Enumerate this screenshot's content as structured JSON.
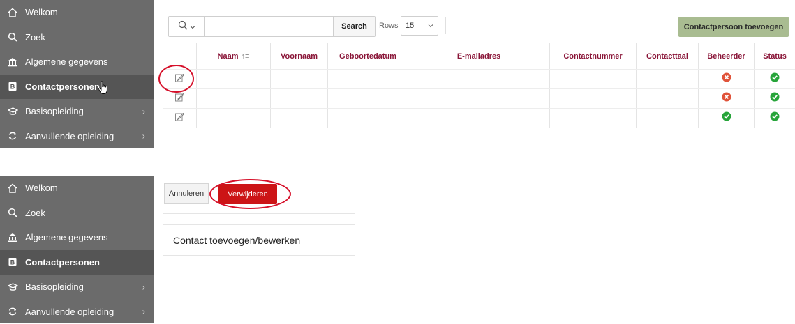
{
  "nav": {
    "items": [
      {
        "label": "Welkom",
        "icon": "home-icon",
        "active": false,
        "chevron": false
      },
      {
        "label": "Zoek",
        "icon": "search-icon",
        "active": false,
        "chevron": false
      },
      {
        "label": "Algemene gegevens",
        "icon": "bank-icon",
        "active": false,
        "chevron": false
      },
      {
        "label": "Contactpersonen",
        "icon": "contact-card-icon",
        "active": true,
        "chevron": false
      },
      {
        "label": "Basisopleiding",
        "icon": "graduation-cap-icon",
        "active": false,
        "chevron": true
      },
      {
        "label": "Aanvullende opleiding",
        "icon": "refresh-icon",
        "active": false,
        "chevron": true
      }
    ]
  },
  "report": {
    "search_value": "",
    "search_button": "Search",
    "rows_label": "Rows",
    "rows_value": "15",
    "add_button": "Contactpersoon toevoegen",
    "columns": [
      "Naam",
      "Voornaam",
      "Geboortedatum",
      "E-mailadres",
      "Contactnummer",
      "Contacttaal",
      "Beheerder",
      "Status"
    ],
    "rows": [
      {
        "beheerder": "no",
        "status": "yes"
      },
      {
        "beheerder": "no",
        "status": "yes"
      },
      {
        "beheerder": "yes",
        "status": "yes"
      }
    ]
  },
  "form": {
    "cancel_button": "Annuleren",
    "delete_button": "Verwijderen",
    "region_title": "Contact toevoegen/bewerken"
  },
  "colors": {
    "sidebar": "#6b6b6b",
    "sidebar_active": "#555555",
    "header_text": "#8a1538",
    "add_button": "#a9bc91",
    "delete_button": "#cc1416",
    "annotation": "#d6102a",
    "status_yes": "#27a43a",
    "status_no": "#e0533a"
  }
}
